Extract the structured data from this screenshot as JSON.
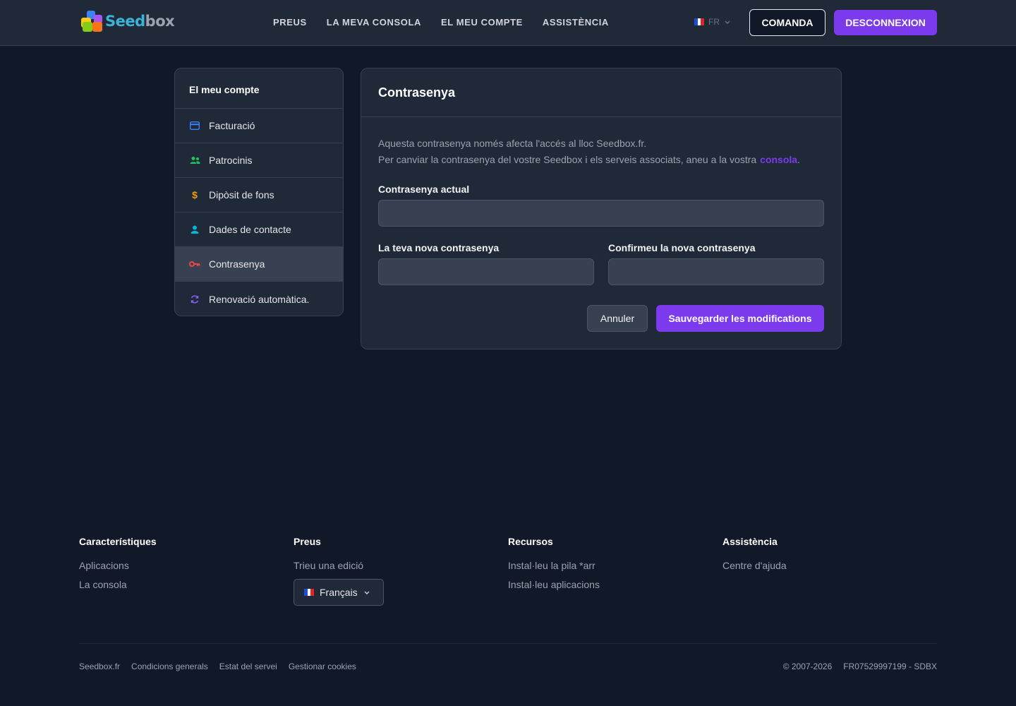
{
  "header": {
    "logo": {
      "part1": "Seed",
      "part2": "box"
    },
    "nav": [
      "PREUS",
      "LA MEVA CONSOLA",
      "EL MEU COMPTE",
      "ASSISTÈNCIA"
    ],
    "lang": "FR",
    "order_label": "COMANDA",
    "logout_label": "DESCONNEXION"
  },
  "sidebar": {
    "title": "El meu compte",
    "items": [
      {
        "label": "Facturació",
        "icon": "credit-card-icon",
        "color": "#3b82f6"
      },
      {
        "label": "Patrocinis",
        "icon": "users-icon",
        "color": "#22c55e"
      },
      {
        "label": "Dipòsit de fons",
        "icon": "dollar-icon",
        "color": "#f59e0b"
      },
      {
        "label": "Dades de contacte",
        "icon": "user-icon",
        "color": "#06b6d4"
      },
      {
        "label": "Contrasenya",
        "icon": "key-icon",
        "color": "#ef4444",
        "active": true
      },
      {
        "label": "Renovació automàtica.",
        "icon": "refresh-icon",
        "color": "#8b5cf6"
      }
    ]
  },
  "card": {
    "title": "Contrasenya",
    "desc_line1": "Aquesta contrasenya només afecta l'accés al lloc Seedbox.fr.",
    "desc_line2": "Per canviar la contrasenya del vostre Seedbox i els serveis associats, aneu a la vostra",
    "desc_link": "consola",
    "current_label": "Contrasenya actual",
    "current_value": "",
    "new_label": "La teva nova contrasenya",
    "new_value": "",
    "confirm_label": "Confirmeu la nova contrasenya",
    "confirm_value": "",
    "cancel_label": "Annuler",
    "save_label": "Sauvegarder les modifications"
  },
  "footer": {
    "columns": [
      {
        "title": "Característiques",
        "links": [
          "Aplicacions",
          "La consola"
        ]
      },
      {
        "title": "Preus",
        "links": [
          "Trieu una edició"
        ]
      },
      {
        "title": "Recursos",
        "links": [
          "Instal·leu la pila *arr",
          "Instal·leu aplicacions"
        ]
      },
      {
        "title": "Assistència",
        "links": [
          "Centre d'ajuda"
        ]
      }
    ],
    "language": "Français",
    "bottom_links": [
      "Seedbox.fr",
      "Condicions generals",
      "Estat del servei",
      "Gestionar cookies"
    ],
    "copyright": "© 2007-2026",
    "company_id": "FR07529997199 - SDBX"
  },
  "colors": {
    "accent": "#7c3aed",
    "background": "#111827",
    "surface": "#1f2937"
  }
}
